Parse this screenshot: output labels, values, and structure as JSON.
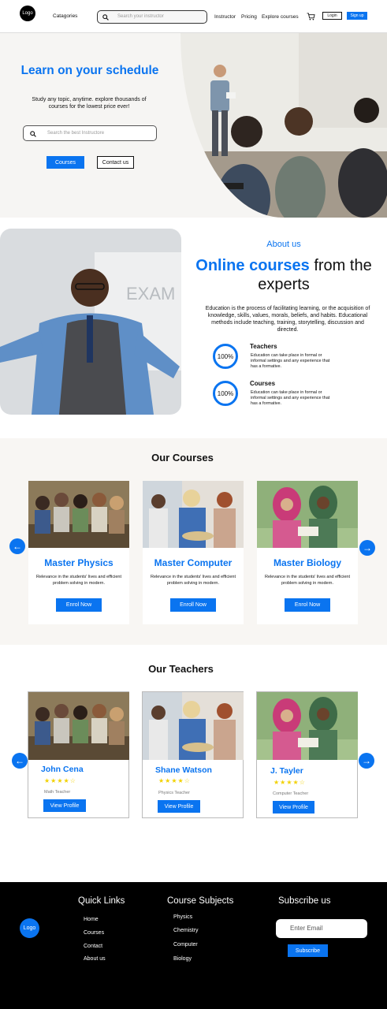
{
  "header": {
    "logo": "Logo",
    "categories": "Catagories",
    "search_placeholder": "Search your instructor",
    "nav": [
      "Instructor",
      "Pricing",
      "Explore courses"
    ],
    "login": "Login",
    "signup": "Sign up"
  },
  "hero": {
    "title": "Learn on your schedule",
    "subtitle": "Study any topic, anytime. explore thousands of courses for the lowest price ever!",
    "search_placeholder": "Search the best Instructore",
    "courses_button": "Courses",
    "contact_button": "Contact us"
  },
  "about": {
    "eyebrow": "About us",
    "title_highlight": "Online courses",
    "title_rest": " from the experts",
    "body": "Education is the process of facilitating learning, or the acquisition of knowledge, skills, values, morals, beliefs, and habits. Educational methods include teaching, training, storytelling, discussion and directed.",
    "features": [
      {
        "percent": "100%",
        "title": "Teachers",
        "desc": "Education can take place in formal or informal settings and any experience that has a formative."
      },
      {
        "percent": "100%",
        "title": "Courses",
        "desc": "Education can take place in formal or informal settings and any experience that has a formative."
      }
    ]
  },
  "courses": {
    "heading": "Our Courses",
    "items": [
      {
        "title": "Master Physics",
        "desc": "Relevance in the students' lives and efficient problem solving in modern.",
        "button": "Enrol Now"
      },
      {
        "title": "Master Computer",
        "desc": "Relevance in the students' lives and efficient problem solving in modern.",
        "button": "Enroll Now"
      },
      {
        "title": "Master Biology",
        "desc": "Relevance in the students' lives and efficient problem solving in modern.",
        "button": "Enrol Now"
      }
    ]
  },
  "teachers": {
    "heading": "Our Teachers",
    "items": [
      {
        "name": "John Cena",
        "rating": 4,
        "stars": "★★★★☆",
        "role": "Math Teacher",
        "button": "View Profile"
      },
      {
        "name": "Shane Watson",
        "rating": 4,
        "stars": "★★★★☆",
        "role": "Physics Teacher",
        "button": "View Profile"
      },
      {
        "name": "J. Tayler",
        "rating": 4,
        "stars": "★★★★☆",
        "role": "Computer Teacher",
        "button": "View Profile"
      }
    ]
  },
  "footer": {
    "logo": "Logo",
    "quick_links_title": "Quick Links",
    "quick_links": [
      "Home",
      "Courses",
      "Contact",
      "About us"
    ],
    "subjects_title": "Course Subjects",
    "subjects": [
      "Physics",
      "Chemistry",
      "Computer",
      "Biology"
    ],
    "subscribe_title": "Subscribe us",
    "email_placeholder": "Enter Email",
    "subscribe_button": "Subscribe"
  },
  "colors": {
    "accent": "#0a74f0",
    "star": "#f2d100",
    "footer_bg": "#000000"
  }
}
